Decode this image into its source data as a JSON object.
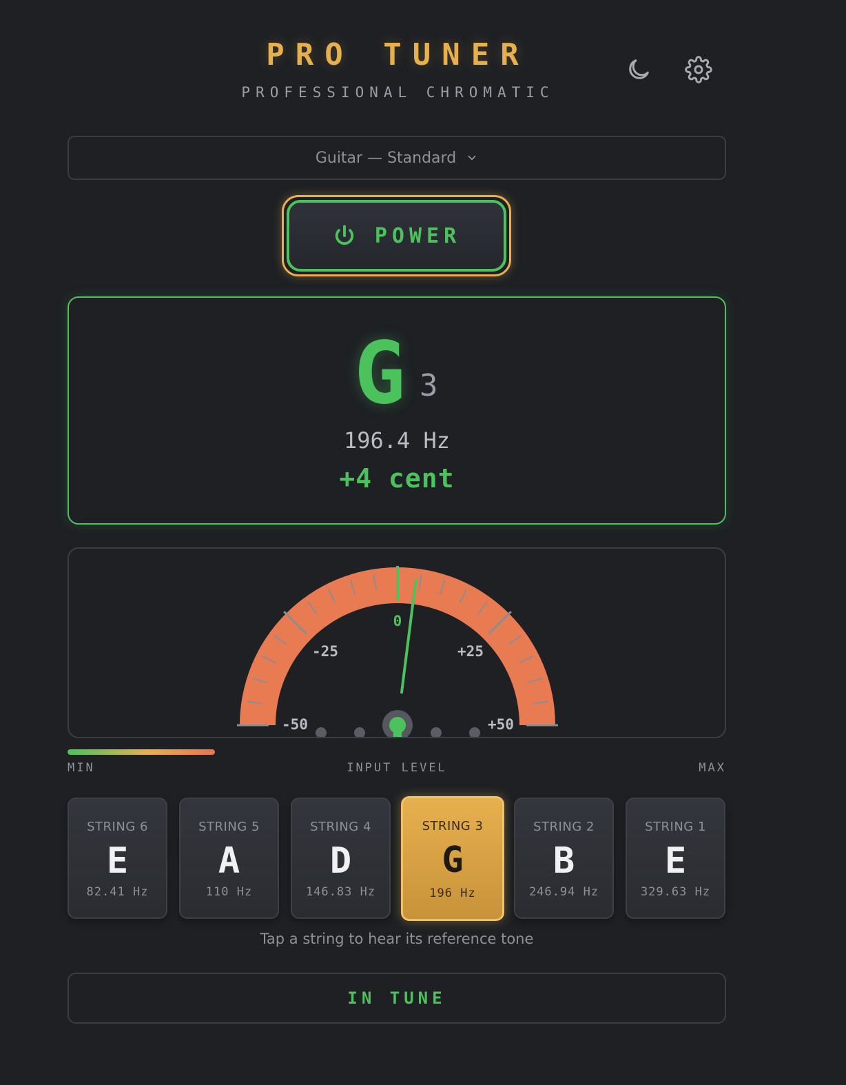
{
  "header": {
    "title": "PRO TUNER",
    "subtitle": "PROFESSIONAL CHROMATIC",
    "theme_icon": "moon-icon",
    "settings_icon": "gear-icon"
  },
  "tuning": {
    "selected": "Guitar — Standard"
  },
  "power": {
    "label": "POWER",
    "icon": "power-icon"
  },
  "display": {
    "note": "G",
    "octave": "3",
    "frequency": "196.4 Hz",
    "cents": "+4 cent"
  },
  "gauge": {
    "labels": {
      "center": "0",
      "minus25": "-25",
      "plus25": "+25",
      "minus50": "-50",
      "plus50": "+50"
    },
    "cents_value": 4,
    "range": [
      -50,
      50
    ]
  },
  "input_level": {
    "min_label": "MIN",
    "title": "INPUT LEVEL",
    "max_label": "MAX",
    "level": 0.224
  },
  "strings": [
    {
      "label": "STRING 6",
      "note": "E",
      "freq": "82.41 Hz"
    },
    {
      "label": "STRING 5",
      "note": "A",
      "freq": "110 Hz"
    },
    {
      "label": "STRING 4",
      "note": "D",
      "freq": "146.83 Hz"
    },
    {
      "label": "STRING 3",
      "note": "G",
      "freq": "196 Hz"
    },
    {
      "label": "STRING 2",
      "note": "B",
      "freq": "246.94 Hz"
    },
    {
      "label": "STRING 1",
      "note": "E",
      "freq": "329.63 Hz"
    }
  ],
  "active_string": 3,
  "hint": "Tap a string to hear its reference tone",
  "status": "IN TUNE",
  "colors": {
    "background": "#1e2024",
    "accent": "#e7b04e",
    "in_tune": "#4cc25d",
    "arc": "#e87b52"
  }
}
